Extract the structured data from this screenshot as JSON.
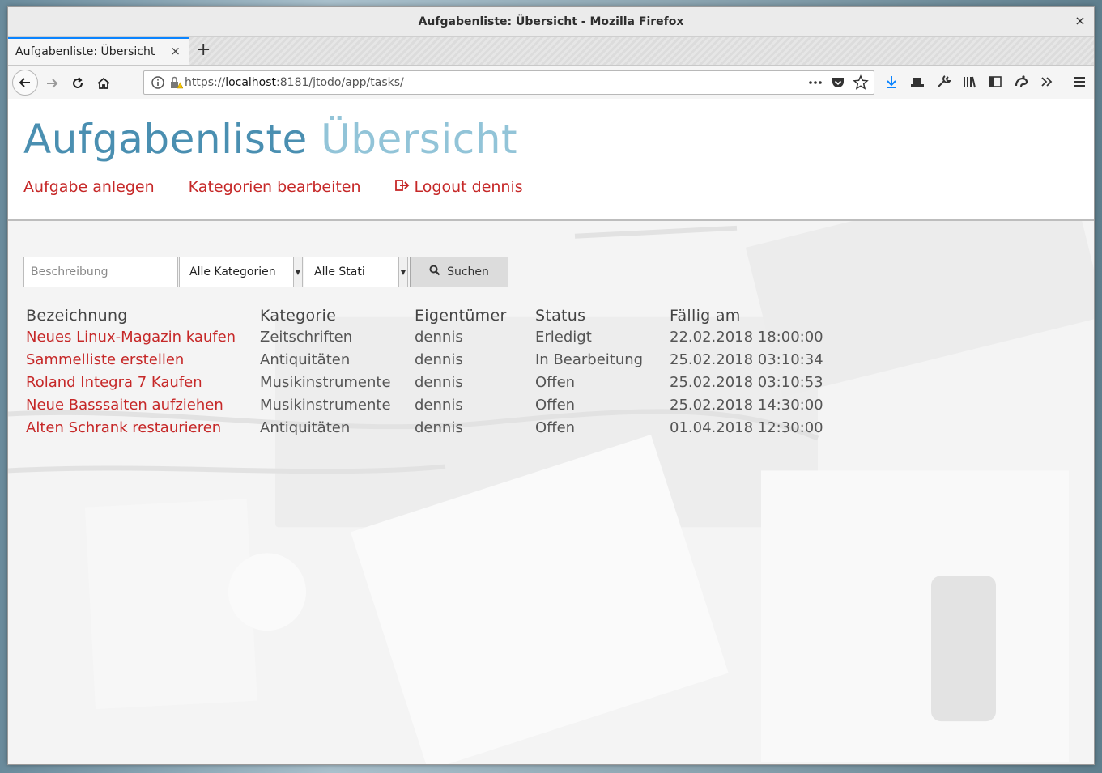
{
  "window": {
    "title": "Aufgabenliste: Übersicht - Mozilla Firefox",
    "close_glyph": "×"
  },
  "tabs": [
    {
      "label": "Aufgabenliste: Übersicht",
      "close_glyph": "×"
    }
  ],
  "newtab_glyph": "+",
  "url": {
    "scheme": "https://",
    "host": "localhost",
    "rest": ":8181/jtodo/app/tasks/"
  },
  "page": {
    "title_main": "Aufgabenliste",
    "title_accent": "Übersicht",
    "nav": {
      "create_task": "Aufgabe anlegen",
      "edit_categories": "Kategorien bearbeiten",
      "logout": "Logout dennis"
    }
  },
  "filter": {
    "description_placeholder": "Beschreibung",
    "category_selected": "Alle Kategorien",
    "status_selected": "Alle Stati",
    "search_label": "Suchen"
  },
  "table": {
    "headers": [
      "Bezeichnung",
      "Kategorie",
      "Eigentümer",
      "Status",
      "Fällig am"
    ],
    "rows": [
      [
        "Neues Linux-Magazin kaufen",
        "Zeitschriften",
        "dennis",
        "Erledigt",
        "22.02.2018 18:00:00"
      ],
      [
        "Sammelliste erstellen",
        "Antiquitäten",
        "dennis",
        "In Bearbeitung",
        "25.02.2018 03:10:34"
      ],
      [
        "Roland Integra 7 Kaufen",
        "Musikinstrumente",
        "dennis",
        "Offen",
        "25.02.2018 03:10:53"
      ],
      [
        "Neue Basssaiten aufziehen",
        "Musikinstrumente",
        "dennis",
        "Offen",
        "25.02.2018 14:30:00"
      ],
      [
        "Alten Schrank restaurieren",
        "Antiquitäten",
        "dennis",
        "Offen",
        "01.04.2018 12:30:00"
      ]
    ]
  },
  "colors": {
    "link": "#c62828",
    "title": "#4a8fb1",
    "title_accent": "#92c4d8"
  }
}
